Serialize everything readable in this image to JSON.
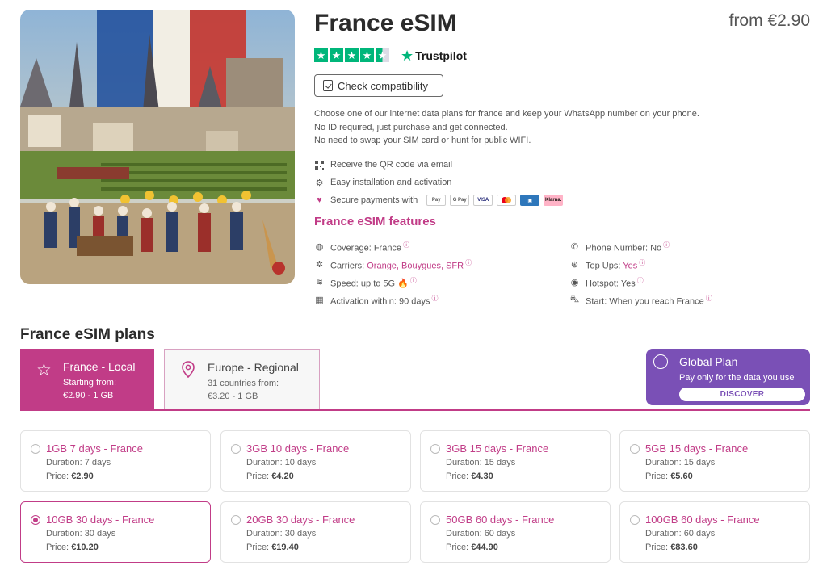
{
  "product": {
    "title": "France eSIM",
    "price_from": "from €2.90",
    "trustpilot": {
      "label": "Trustpilot",
      "rating_stars": 4.5
    },
    "check_button": "Check compatibility",
    "description": [
      "Choose one of our internet data plans for france and keep your WhatsApp number on your phone.",
      "No ID required, just purchase and get connected.",
      "No need to swap your SIM card or hunt for public WIFI."
    ],
    "bullets": [
      {
        "icon": "qr-code-icon",
        "text": "Receive the QR code via email"
      },
      {
        "icon": "gear-icon",
        "text": "Easy installation and activation"
      },
      {
        "icon": "secure-icon",
        "text": "Secure payments with"
      }
    ],
    "payments": [
      "Pay",
      "G Pay",
      "VISA",
      "Mastercard",
      "AmEx",
      "Klarna."
    ]
  },
  "features": {
    "title": "France eSIM features",
    "left": [
      {
        "icon": "globe-icon",
        "label": "Coverage: ",
        "value": "France",
        "link": false
      },
      {
        "icon": "carrier-icon",
        "label": "Carriers: ",
        "value": "Orange, Bouygues, SFR",
        "link": true
      },
      {
        "icon": "signal-icon",
        "label": "Speed: ",
        "value": "up to 5G 🔥",
        "link": false
      },
      {
        "icon": "calendar-icon",
        "label": "Activation within: ",
        "value": "90 days",
        "link": false
      }
    ],
    "right": [
      {
        "icon": "phone-icon",
        "label": "Phone Number: ",
        "value": "No",
        "link": false
      },
      {
        "icon": "topup-icon",
        "label": "Top Ups: ",
        "value": "Yes",
        "link": true
      },
      {
        "icon": "hotspot-icon",
        "label": "Hotspot: ",
        "value": "Yes",
        "link": false
      },
      {
        "icon": "car-icon",
        "label": "Start: ",
        "value": "When you reach France",
        "link": false
      }
    ],
    "info_mark": "ⓘ"
  },
  "plans": {
    "title": "France eSIM plans",
    "tabs": [
      {
        "name": "France - Local",
        "sub1": "Starting from:",
        "sub2": "€2.90 - 1 GB"
      },
      {
        "name": "Europe - Regional",
        "sub1": "31 countries from:",
        "sub2": "€3.20 - 1 GB"
      }
    ],
    "global": {
      "name": "Global Plan",
      "sub": "Pay only for the data you use",
      "button": "DISCOVER"
    },
    "items": [
      {
        "name": "1GB 7 days - France",
        "duration": "Duration: 7 days",
        "price_label": "Price: ",
        "price": "€2.90",
        "selected": false
      },
      {
        "name": "3GB 10 days - France",
        "duration": "Duration: 10 days",
        "price_label": "Price: ",
        "price": "€4.20",
        "selected": false
      },
      {
        "name": "3GB 15 days - France",
        "duration": "Duration: 15 days",
        "price_label": "Price: ",
        "price": "€4.30",
        "selected": false
      },
      {
        "name": "5GB 15 days - France",
        "duration": "Duration: 15 days",
        "price_label": "Price: ",
        "price": "€5.60",
        "selected": false
      },
      {
        "name": "10GB 30 days - France",
        "duration": "Duration: 30 days",
        "price_label": "Price: ",
        "price": "€10.20",
        "selected": true
      },
      {
        "name": "20GB 30 days - France",
        "duration": "Duration: 30 days",
        "price_label": "Price: ",
        "price": "€19.40",
        "selected": false
      },
      {
        "name": "50GB 60 days - France",
        "duration": "Duration: 60 days",
        "price_label": "Price: ",
        "price": "€44.90",
        "selected": false
      },
      {
        "name": "100GB 60 days - France",
        "duration": "Duration: 60 days",
        "price_label": "Price: ",
        "price": "€83.60",
        "selected": false
      }
    ]
  }
}
